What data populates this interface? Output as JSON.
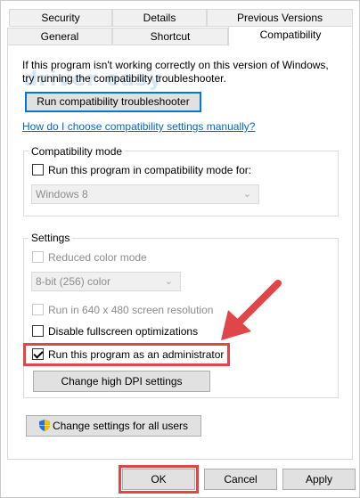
{
  "tabs": {
    "row1": [
      "Security",
      "Details",
      "Previous Versions"
    ],
    "row2": [
      "General",
      "Shortcut",
      "Compatibility"
    ],
    "active": "Compatibility"
  },
  "intro_text": "If this program isn't working correctly on this version of Windows, try running the compatibility troubleshooter.",
  "watermark": "driver easy",
  "troubleshooter_button": "Run compatibility troubleshooter",
  "manual_link": "How do I choose compatibility settings manually?",
  "compat_mode": {
    "label": "Compatibility mode",
    "checkbox_label": "Run this program in compatibility mode for:",
    "checked": false,
    "os_select": "Windows 8"
  },
  "settings": {
    "label": "Settings",
    "reduced_color": {
      "label": "Reduced color mode",
      "checked": false
    },
    "color_select": "8-bit (256) color",
    "res_640": {
      "label": "Run in 640 x 480 screen resolution",
      "checked": false
    },
    "disable_fullscreen": {
      "label": "Disable fullscreen optimizations",
      "checked": false
    },
    "run_as_admin": {
      "label": "Run this program as an administrator",
      "checked": true
    },
    "dpi_button": "Change high DPI settings"
  },
  "all_users_button": "Change settings for all users",
  "footer": {
    "ok": "OK",
    "cancel": "Cancel",
    "apply": "Apply"
  },
  "colors": {
    "accent_red": "#e0454a",
    "link": "#0066cc",
    "focus": "#0078d7"
  },
  "icons": {
    "shield": "uac-shield-icon"
  }
}
